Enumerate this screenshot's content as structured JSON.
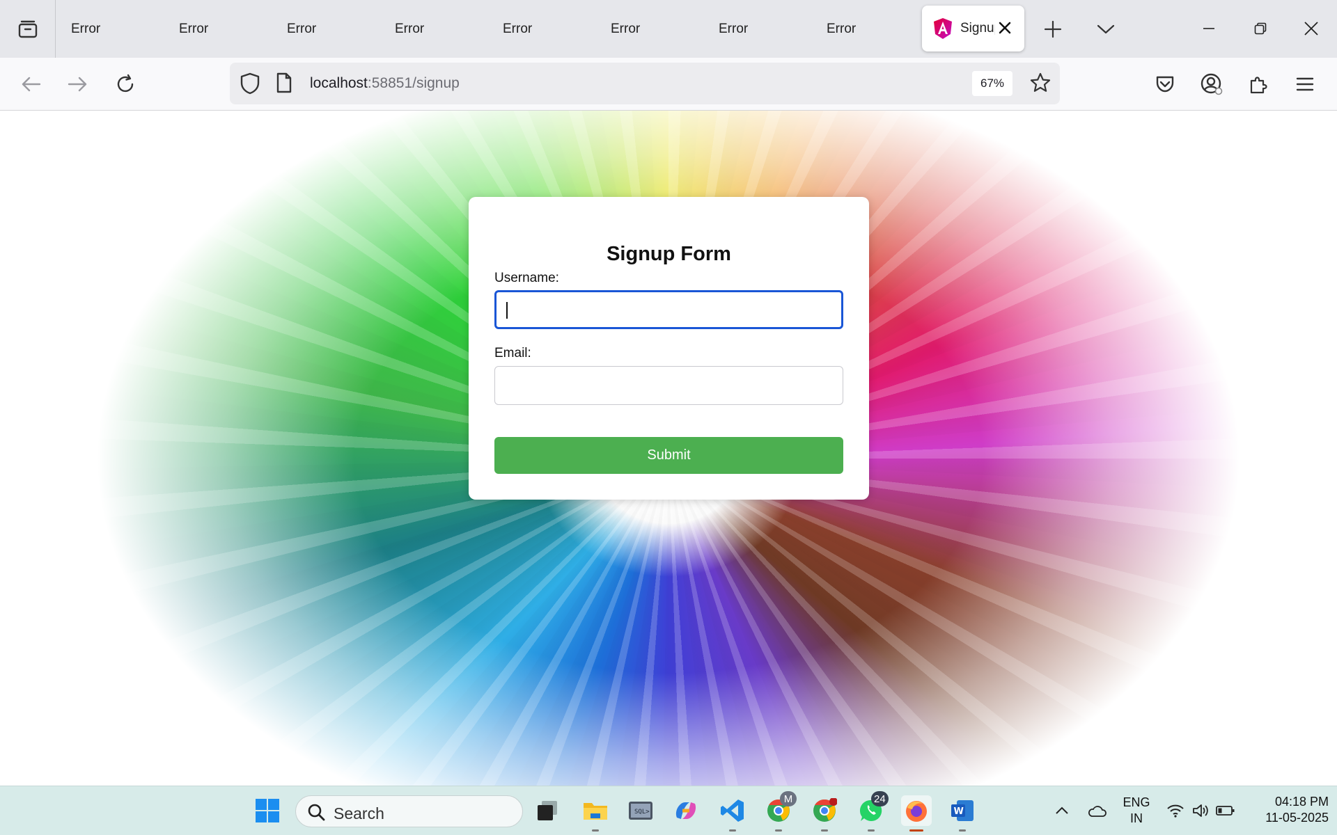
{
  "browser": {
    "tabs": [
      {
        "label": "Error"
      },
      {
        "label": "Error"
      },
      {
        "label": "Error"
      },
      {
        "label": "Error"
      },
      {
        "label": "Error"
      },
      {
        "label": "Error"
      },
      {
        "label": "Error"
      },
      {
        "label": "Error"
      }
    ],
    "active_tab": {
      "label": "Signup"
    },
    "url_host": "localhost",
    "url_rest": ":58851/signup",
    "zoom": "67%"
  },
  "form": {
    "title": "Signup Form",
    "username_label": "Username:",
    "username_value": "",
    "email_label": "Email:",
    "email_value": "",
    "submit_label": "Submit"
  },
  "taskbar": {
    "search_placeholder": "Search",
    "chrome_profile_badge": "M",
    "whatsapp_badge": "24",
    "lang_line1": "ENG",
    "lang_line2": "IN",
    "time": "04:18 PM",
    "date": "11-05-2025"
  },
  "colors": {
    "submit": "#4caf50",
    "focus_border": "#1a56d6",
    "taskbar": "#d7ebe9"
  }
}
